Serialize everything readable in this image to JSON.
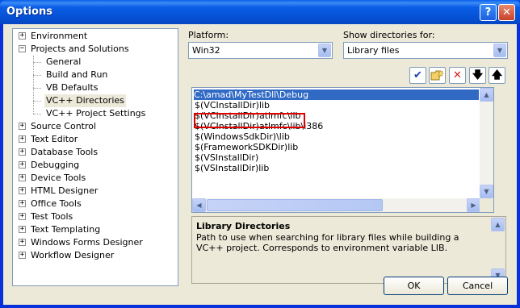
{
  "window": {
    "title": "Options",
    "help_label": "?",
    "close_label": "✕"
  },
  "tree": {
    "items": [
      {
        "label": "Environment",
        "expander": "+"
      },
      {
        "label": "Projects and Solutions",
        "expander": "−"
      },
      {
        "label": "General"
      },
      {
        "label": "Build and Run"
      },
      {
        "label": "VB Defaults"
      },
      {
        "label": "VC++ Directories",
        "selected": true
      },
      {
        "label": "VC++ Project Settings"
      },
      {
        "label": "Source Control",
        "expander": "+"
      },
      {
        "label": "Text Editor",
        "expander": "+"
      },
      {
        "label": "Database Tools",
        "expander": "+"
      },
      {
        "label": "Debugging",
        "expander": "+"
      },
      {
        "label": "Device Tools",
        "expander": "+"
      },
      {
        "label": "HTML Designer",
        "expander": "+"
      },
      {
        "label": "Office Tools",
        "expander": "+"
      },
      {
        "label": "Test Tools",
        "expander": "+"
      },
      {
        "label": "Text Templating",
        "expander": "+"
      },
      {
        "label": "Windows Forms Designer",
        "expander": "+"
      },
      {
        "label": "Workflow Designer",
        "expander": "+"
      }
    ]
  },
  "platform": {
    "label": "Platform:",
    "value": "Win32"
  },
  "show_dirs": {
    "label": "Show directories for:",
    "value": "Library files"
  },
  "toolbar": {
    "check_icon": "checkmark-icon",
    "newfolder_icon": "new-folder-icon",
    "delete_icon": "delete-x-icon",
    "down_icon": "move-down-icon",
    "up_icon": "move-up-icon"
  },
  "directories": [
    "C:\\amad\\MyTestDll\\Debug",
    "$(VCInstallDir)lib",
    "$(VCInstallDir)atlmfc\\lib",
    "$(VCInstallDir)atlmfc\\lib\\i386",
    "$(WindowsSdkDir)\\lib",
    "$(FrameworkSDKDir)lib",
    "$(VSInstallDir)",
    "$(VSInstallDir)lib"
  ],
  "description": {
    "title": "Library Directories",
    "body": "Path to use when searching for library files while building a VC++ project. Corresponds to environment variable LIB."
  },
  "buttons": {
    "ok": "OK",
    "cancel": "Cancel"
  }
}
